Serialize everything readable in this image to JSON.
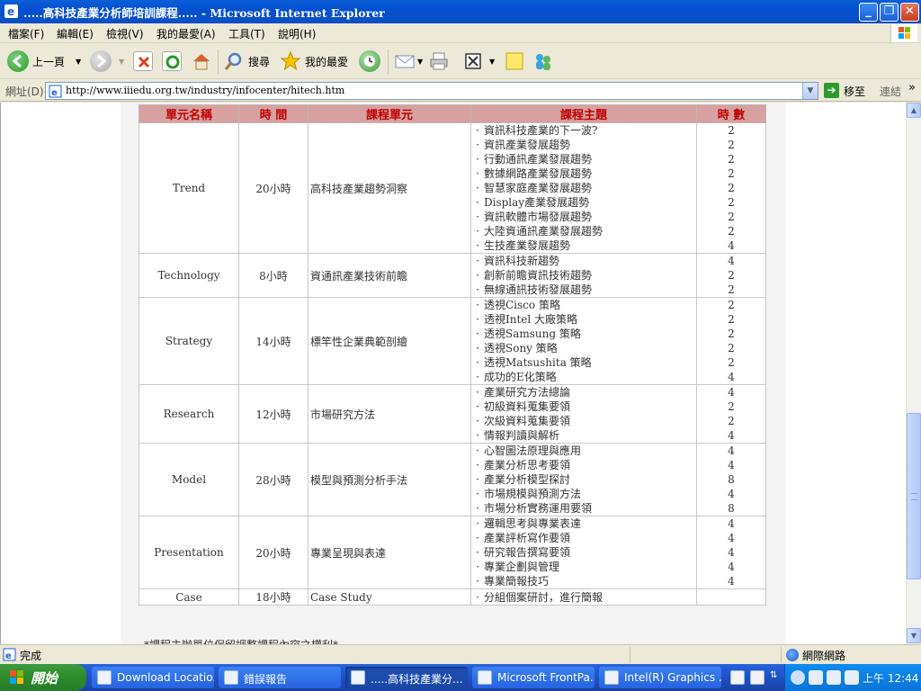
{
  "window": {
    "title": ".....高科技產業分析師培訓課程..... - Microsoft Internet Explorer"
  },
  "menu": [
    "檔案(F)",
    "編輯(E)",
    "檢視(V)",
    "我的最愛(A)",
    "工具(T)",
    "說明(H)"
  ],
  "toolbar": {
    "back_label": "上一頁",
    "search_label": "搜尋",
    "favorites_label": "我的最愛"
  },
  "address": {
    "label": "網址(D)",
    "url": "http://www.iiiedu.org.tw/industry/infocenter/hitech.htm",
    "go_label": "移至",
    "links_label": "連結"
  },
  "table": {
    "headers": [
      "單元名稱",
      "時 間",
      "課程單元",
      "課程主題",
      "時 數"
    ],
    "rows": [
      {
        "unit": "Trend",
        "time": "20小時",
        "course": "高科技產業趨勢洞察",
        "topics": [
          "資訊科技產業的下一波?",
          "資訊產業發展趨勢",
          "行動通訊產業發展趨勢",
          "數據網路產業發展趨勢",
          "智慧家庭產業發展趨勢",
          "Display產業發展趨勢",
          "資訊軟體市場發展趨勢",
          "大陸資通訊產業發展趨勢",
          "生技產業發展趨勢"
        ],
        "hours": [
          "2",
          "2",
          "2",
          "2",
          "2",
          "2",
          "2",
          "2",
          "4"
        ]
      },
      {
        "unit": "Technology",
        "time": "8小時",
        "course": "資通訊產業技術前瞻",
        "topics": [
          "資訊科技新趨勢",
          "創新前瞻資訊技術趨勢",
          "無線通訊技術發展趨勢"
        ],
        "hours": [
          "4",
          "2",
          "2"
        ]
      },
      {
        "unit": "Strategy",
        "time": "14小時",
        "course": "標竿性企業典範剖繪",
        "topics": [
          "透視Cisco 策略",
          "透視Intel 大廠策略",
          "透視Samsung 策略",
          "透視Sony 策略",
          "透視Matsushita 策略",
          "成功的E化策略"
        ],
        "hours": [
          "2",
          "2",
          "2",
          "2",
          "2",
          "4"
        ]
      },
      {
        "unit": "Research",
        "time": "12小時",
        "course": "市場研究方法",
        "topics": [
          "產業研究方法總論",
          "初級資料蒐集要領",
          "次級資料蒐集要領",
          "情報判讀與解析"
        ],
        "hours": [
          "4",
          "2",
          "2",
          "4"
        ]
      },
      {
        "unit": "Model",
        "time": "28小時",
        "course": "模型與預測分析手法",
        "topics": [
          "心智圖法原理與應用",
          "產業分析思考要領",
          "產業分析模型探討",
          "市場規模與預測方法",
          "市場分析實務運用要領"
        ],
        "hours": [
          "4",
          "4",
          "8",
          "4",
          "8"
        ]
      },
      {
        "unit": "Presentation",
        "time": "20小時",
        "course": "專業呈現與表達",
        "topics": [
          "邏輯思考與專業表達",
          "產業評析寫作要領",
          "研究報告撰寫要領",
          "專業企劃與管理",
          "專業簡報技巧"
        ],
        "hours": [
          "4",
          "4",
          "4",
          "4",
          "4"
        ]
      },
      {
        "unit": "Case",
        "time": "18小時",
        "course": "Case Study",
        "topics": [
          "分組個案研討，進行簡報"
        ],
        "hours": [
          ""
        ]
      }
    ]
  },
  "footnote": "*課程主辦單位保留調整課程內容之權利*",
  "status": {
    "text": "完成",
    "zone": "網際網路"
  },
  "taskbar": {
    "start_label": "開始",
    "tasks": [
      "Download Locatio...",
      "錯誤報告",
      ".....高科技產業分...",
      "Microsoft FrontPa...",
      "Intel(R) Graphics ..."
    ],
    "clock": "上午 12:44"
  },
  "colors": {
    "header_bg": "#d8a0a0",
    "header_text": "#c00000",
    "titlebar": "#0a5fd8"
  }
}
